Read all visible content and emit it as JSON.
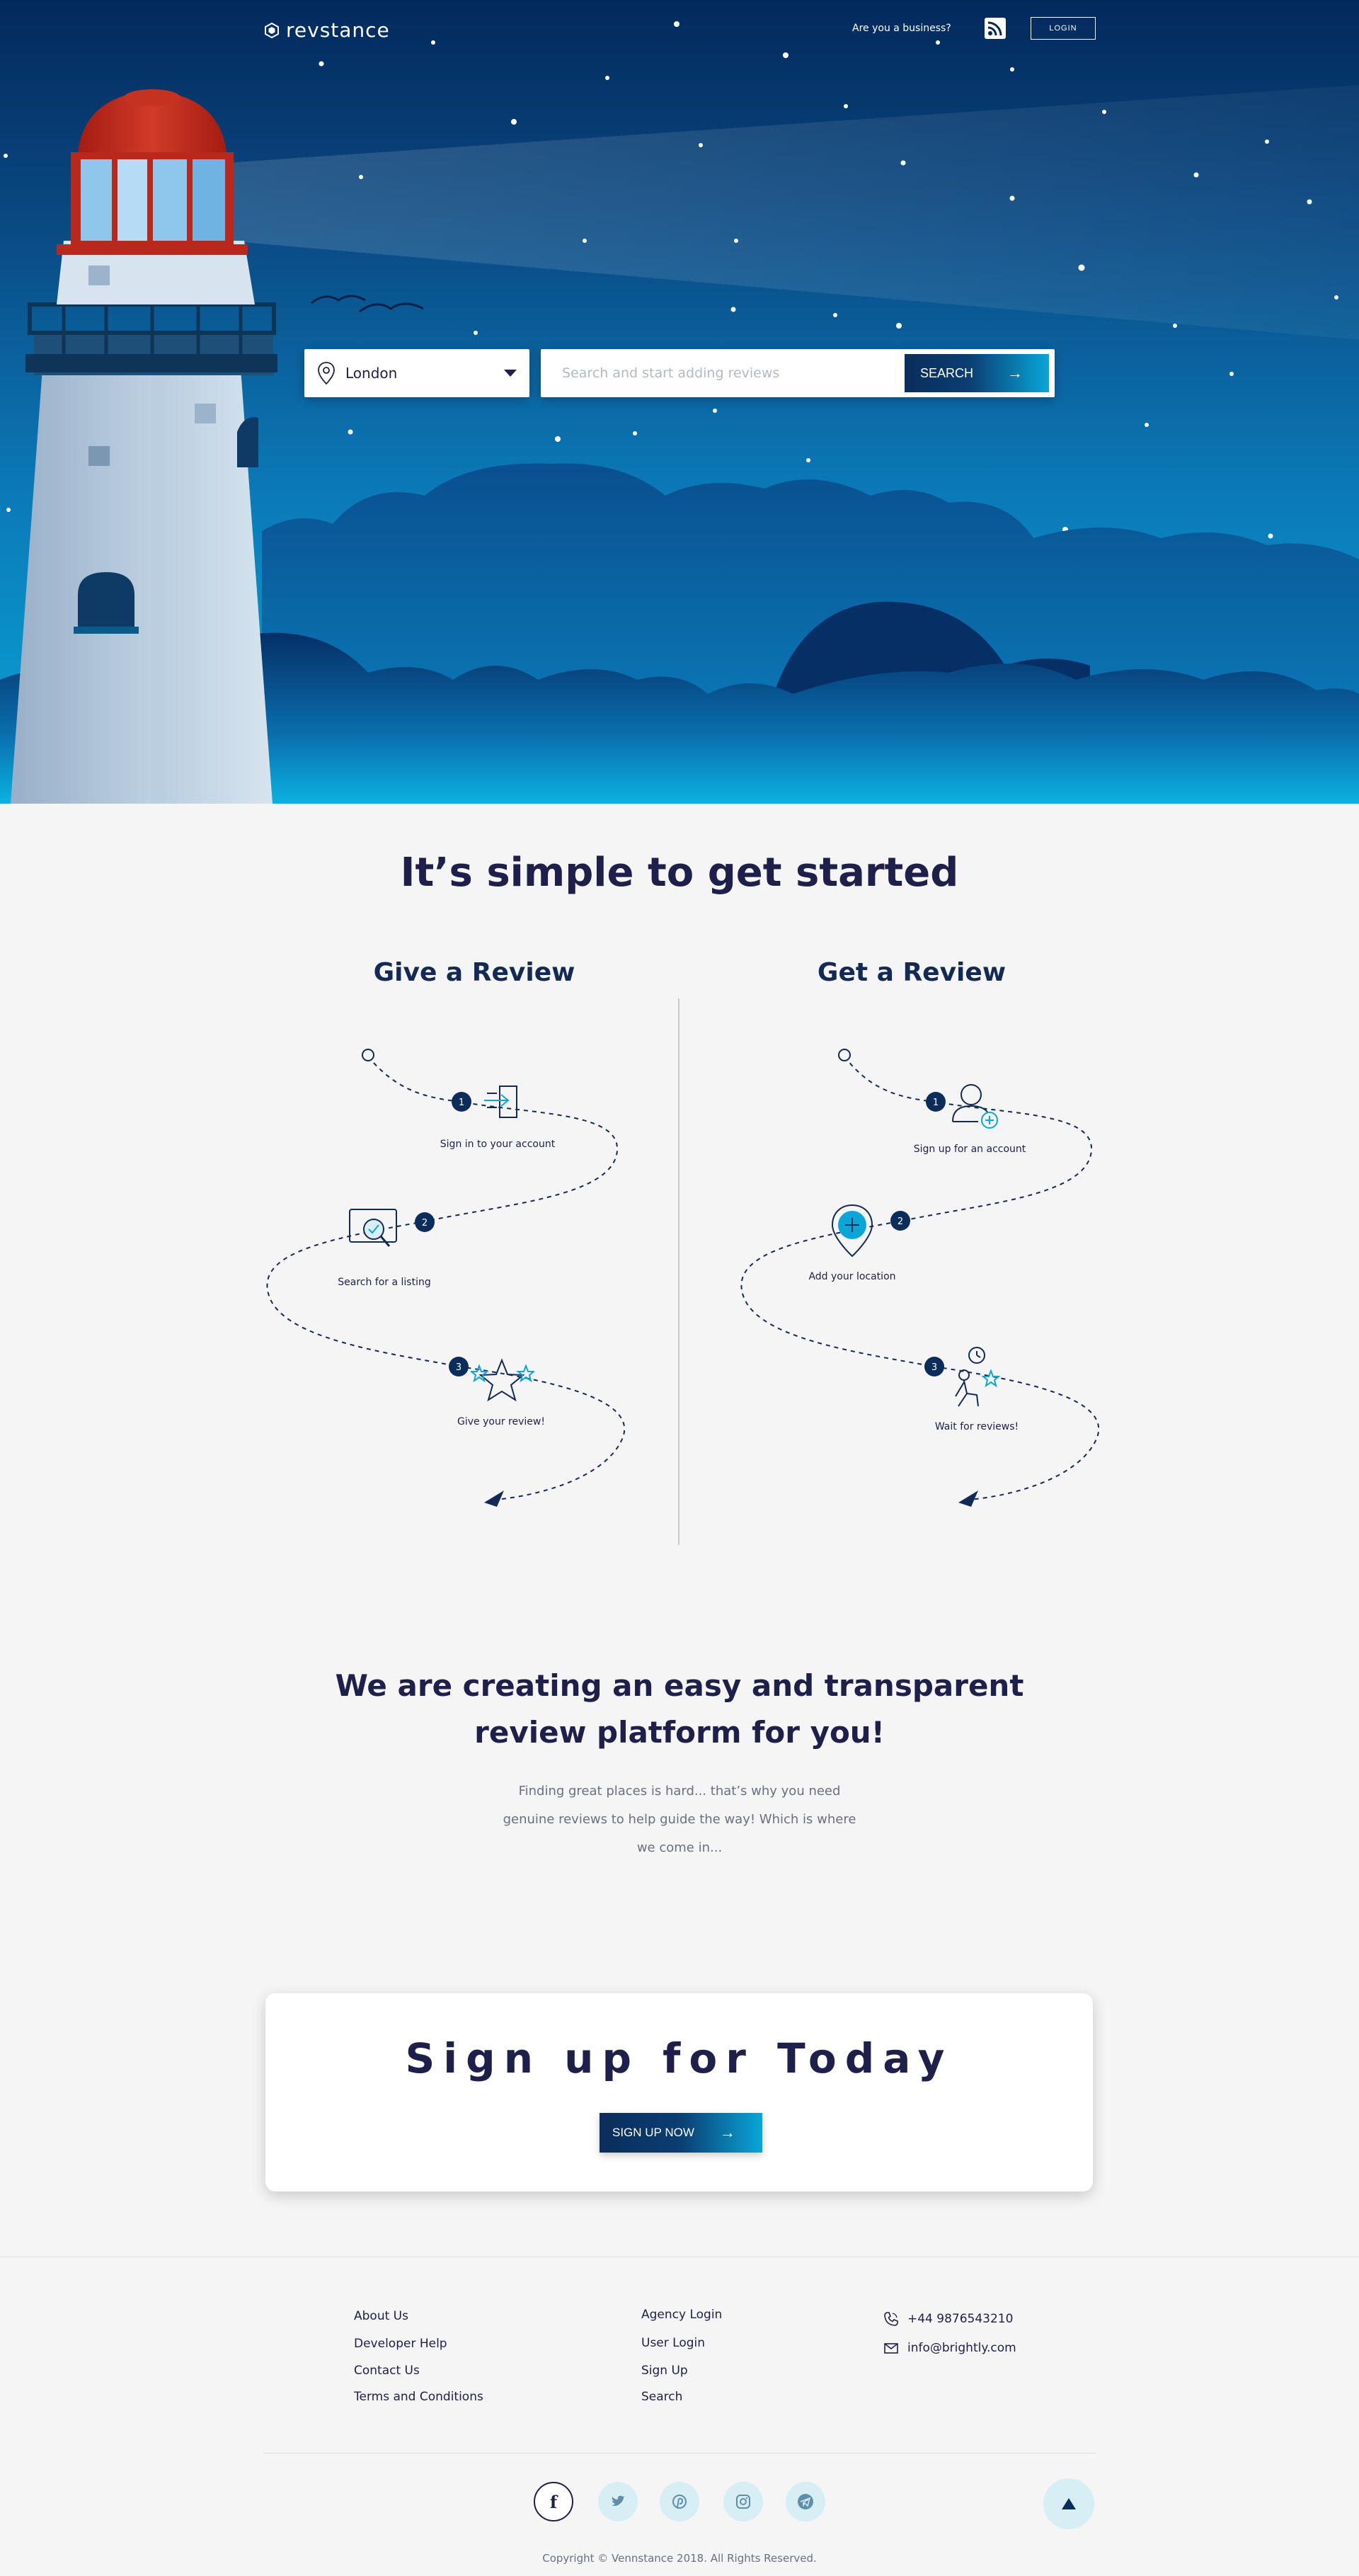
{
  "brand": {
    "logo_text": "revstance"
  },
  "header": {
    "business_link": "Are you a business?",
    "login_label": "LOGIN"
  },
  "search": {
    "location_value": "London",
    "placeholder": "Search and start adding reviews",
    "button_label": "SEARCH"
  },
  "steps": {
    "title": "It’s simple to get started",
    "give": {
      "title": "Give a Review",
      "items": [
        {
          "num": "1",
          "label": "Sign in to your account",
          "icon": "sign-in-icon"
        },
        {
          "num": "2",
          "label": "Search for a listing",
          "icon": "search-listing-icon"
        },
        {
          "num": "3",
          "label": "Give your review!",
          "icon": "stars-icon"
        }
      ]
    },
    "get": {
      "title": "Get a Review",
      "items": [
        {
          "num": "1",
          "label": "Sign up for an account",
          "icon": "add-user-icon"
        },
        {
          "num": "2",
          "label": "Add your location",
          "icon": "add-location-icon"
        },
        {
          "num": "3",
          "label": "Wait for reviews!",
          "icon": "waiting-person-icon"
        }
      ]
    }
  },
  "platform": {
    "title_line1": "We are creating an easy and transparent",
    "title_line2": "review platform for you!",
    "text": "Finding great places is hard... that’s why you need genuine reviews to help guide the way! Which is where we come in..."
  },
  "signup": {
    "title": "Sign up for Today",
    "button_label": "SIGN UP NOW"
  },
  "footer": {
    "col1": [
      "About Us",
      "Developer Help",
      "Contact Us",
      "Terms and Conditions"
    ],
    "col2": [
      "Agency Login",
      "User Login",
      "Sign Up",
      "Search"
    ],
    "phone": "+44 9876543210",
    "email": "info@brightly.com",
    "social_icons": [
      "facebook-icon",
      "twitter-icon",
      "pinterest-icon",
      "instagram-icon",
      "telegram-icon"
    ],
    "copyright": "Copyright © Vennstance 2018. All Rights Reserved."
  },
  "colors": {
    "navy": "#1e1f4b",
    "dark_blue": "#0a2d5c",
    "cyan": "#0aa6d8",
    "lighthouse_red": "#b8281c",
    "page_bg": "#f5f5f5"
  }
}
